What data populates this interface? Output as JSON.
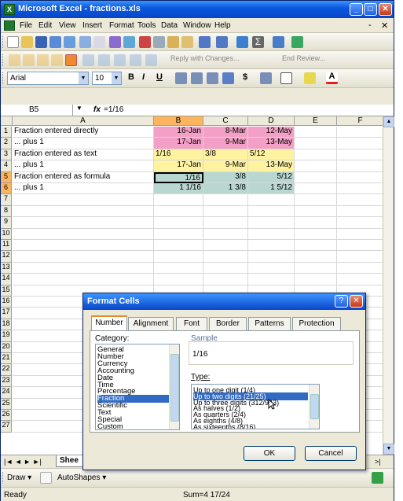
{
  "window": {
    "title": "Microsoft Excel - fractions.xls",
    "minimize": "_",
    "maximize": "□",
    "close": "✕"
  },
  "menu": {
    "items": [
      "File",
      "Edit",
      "View",
      "Insert",
      "Format",
      "Tools",
      "Data",
      "Window",
      "Help"
    ],
    "minimize": "-",
    "close": "✕"
  },
  "toolbar": {
    "font_name": "Arial",
    "font_size": "10",
    "bold": "B",
    "italic": "I",
    "underline": "U",
    "currency": "$",
    "reply_text": "Reply with Changes...",
    "end_review": "End Review..."
  },
  "formula_bar": {
    "name_box": "B5",
    "fx": "fx",
    "formula": "=1/16"
  },
  "grid": {
    "columns": [
      "A",
      "B",
      "C",
      "D",
      "E",
      "F"
    ],
    "rows": [
      [
        "Fraction entered directly",
        "16-Jan",
        "8-Mar",
        "12-May"
      ],
      [
        "... plus 1",
        "17-Jan",
        "9-Mar",
        "13-May"
      ],
      [
        "Fraction entered as text",
        "1/16",
        "3/8",
        "5/12"
      ],
      [
        "... plus 1",
        "17-Jan",
        "9-Mar",
        "13-May"
      ],
      [
        "Fraction entered as formula",
        "1/16",
        "3/8",
        "5/12"
      ],
      [
        "... plus 1",
        "1 1/16",
        "1 3/8",
        "1 5/12"
      ]
    ],
    "row_numbers": [
      "1",
      "2",
      "3",
      "4",
      "5",
      "6",
      "7",
      "8",
      "9",
      "10",
      "11",
      "12",
      "13",
      "14",
      "15",
      "16",
      "17",
      "18",
      "19",
      "20",
      "21",
      "22",
      "23",
      "24",
      "25",
      "26",
      "27"
    ]
  },
  "sheet_tabs": {
    "nav": "|◄ ◄ ► ►|",
    "active": "Shee"
  },
  "draw_toolbar": {
    "draw": "Draw ▾",
    "autoshapes": "AutoShapes ▾"
  },
  "status": {
    "ready": "Ready",
    "sum": "Sum=4 17/24"
  },
  "dialog": {
    "title": "Format Cells",
    "help": "?",
    "close": "✕",
    "tabs": [
      "Number",
      "Alignment",
      "Font",
      "Border",
      "Patterns",
      "Protection"
    ],
    "category_label": "Category:",
    "categories": [
      "General",
      "Number",
      "Currency",
      "Accounting",
      "Date",
      "Time",
      "Percentage",
      "Fraction",
      "Scientific",
      "Text",
      "Special",
      "Custom"
    ],
    "selected_category": "Fraction",
    "sample_label": "Sample",
    "sample_value": "1/16",
    "type_label": "Type:",
    "types": [
      "Up to one digit (1/4)",
      "Up to two digits (21/25)",
      "Up to three digits (312/943)",
      "As halves (1/2)",
      "As quarters (2/4)",
      "As eighths (4/8)",
      "As sixteenths (8/16)"
    ],
    "selected_type": "Up to two digits (21/25)",
    "ok": "OK",
    "cancel": "Cancel"
  }
}
